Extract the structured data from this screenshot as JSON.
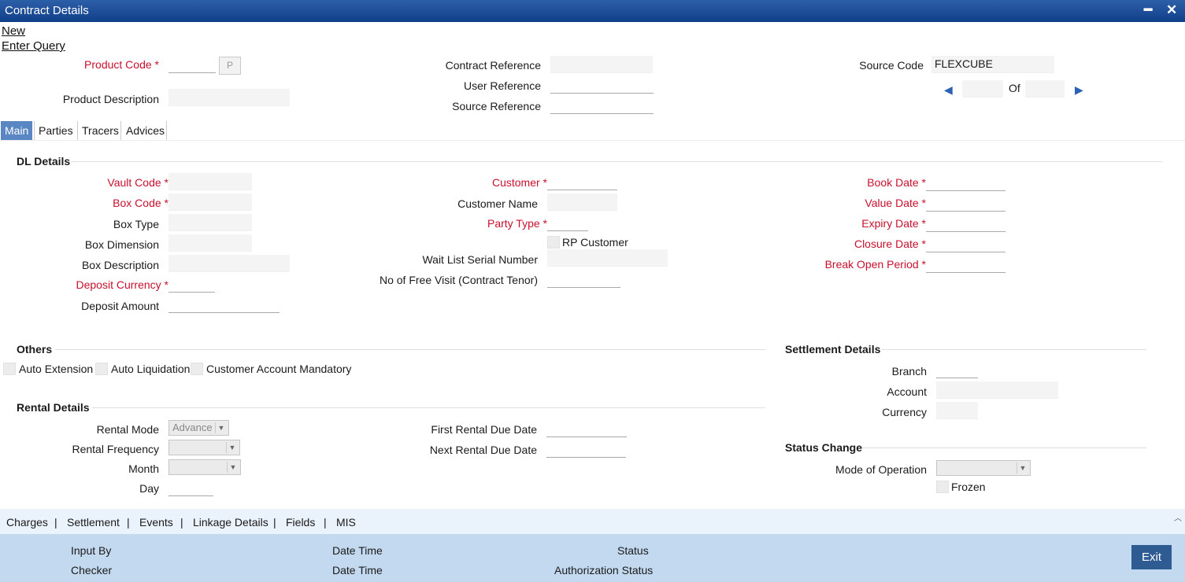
{
  "window": {
    "title": "Contract Details"
  },
  "links": {
    "new": "New",
    "enter_query": "Enter Query"
  },
  "header": {
    "product_code_label": "Product Code",
    "p_button": "P",
    "product_description_label": "Product Description",
    "contract_reference_label": "Contract Reference",
    "user_reference_label": "User Reference",
    "source_reference_label": "Source Reference",
    "source_code_label": "Source Code",
    "source_code_value": "FLEXCUBE",
    "of_label": "Of"
  },
  "tabs": [
    "Main",
    "Parties",
    "Tracers",
    "Advices"
  ],
  "dl_details": {
    "title": "DL Details",
    "vault_code": "Vault Code",
    "box_code": "Box Code",
    "box_type": "Box Type",
    "box_dimension": "Box Dimension",
    "box_description": "Box Description",
    "deposit_currency": "Deposit Currency",
    "deposit_amount": "Deposit Amount",
    "customer": "Customer",
    "customer_name": "Customer Name",
    "party_type": "Party Type",
    "rp_customer": "RP Customer",
    "wait_list": "Wait List Serial Number",
    "free_visit": "No of Free Visit (Contract Tenor)",
    "book_date": "Book Date",
    "value_date": "Value Date",
    "expiry_date": "Expiry Date",
    "closure_date": "Closure Date",
    "break_open": "Break Open Period"
  },
  "others": {
    "title": "Others",
    "auto_extension": "Auto Extension",
    "auto_liquidation": "Auto Liquidation",
    "customer_account_mandatory": "Customer Account Mandatory"
  },
  "settlement": {
    "title": "Settlement Details",
    "branch": "Branch",
    "account": "Account",
    "currency": "Currency"
  },
  "rental": {
    "title": "Rental Details",
    "rental_mode": "Rental Mode",
    "rental_mode_value": "Advance",
    "rental_frequency": "Rental Frequency",
    "month": "Month",
    "day": "Day",
    "first_due": "First Rental Due Date",
    "next_due": "Next Rental Due Date"
  },
  "status_change": {
    "title": "Status Change",
    "mode_of_operation": "Mode of Operation",
    "frozen": "Frozen"
  },
  "bottom_tabs": [
    "Charges",
    "Settlement",
    "Events",
    "Linkage Details",
    "Fields",
    "MIS"
  ],
  "footer": {
    "input_by": "Input By",
    "checker": "Checker",
    "date_time": "Date Time",
    "status": "Status",
    "authorization_status": "Authorization Status",
    "exit": "Exit"
  },
  "colors": {
    "title_bar": "#1a4a94",
    "required": "#c8102e",
    "footer": "#c3d9ef",
    "exit_button": "#2e5c92",
    "active_tab": "#5a86c4"
  }
}
